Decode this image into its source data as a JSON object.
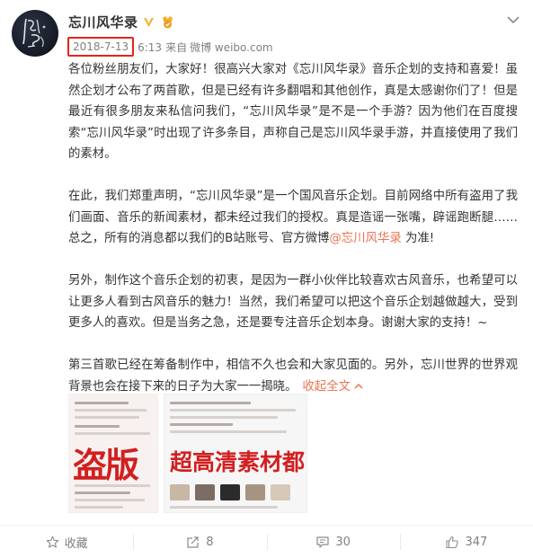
{
  "post": {
    "author": "忘川风华录",
    "date": "2018-7-13",
    "time": "6:13",
    "source_prefix": "来自",
    "source": "微博 weibo.com"
  },
  "content": {
    "p1": "各位粉丝朋友们，大家好！很高兴大家对《忘川风华录》音乐企划的支持和喜爱！虽然企划才公布了两首歌，但是已经有许多翻唱和其他创作，真是太感谢你们了！但是最近有很多朋友来私信问我们，“忘川风华录”是不是一个手游？因为他们在百度搜索“忘川风华录”时出现了许多条目，声称自己是忘川风华录手游，并直接使用了我们的素材。",
    "p2_before": "在此，我们郑重声明，“忘川风华录”是一个国风音乐企划。目前网络中所有盗用了我们画面、音乐的新闻素材，都未经过我们的授权。真是造谣一张嘴，辟谣跑断腿……总之，所有的消息都以我们的B站账号、官方微博",
    "p2_mention": "@忘川风华录",
    "p2_after": " 为准!",
    "p3": "另外，制作这个音乐企划的初衷，是因为一群小伙伴比较喜欢古风音乐，也希望可以让更多人看到古风音乐的魅力！当然，我们希望可以把这个音乐企划越做越大，受到更多人的喜欢。但是当务之急，还是要专注音乐企划本身。谢谢大家的支持！~",
    "p4": "第三首歌已经在筹备制作中，相信不久也会和大家见面的。另外，忘川世界的世界观背景也会在接下来的日子为大家一一揭晓。",
    "collapse_label": "收起全文",
    "collapse_arrow": "^"
  },
  "images": [
    {
      "text": "盗版"
    },
    {
      "text": "超高清素材都"
    }
  ],
  "actions": {
    "favorite_label": "收藏",
    "repost_count": "8",
    "comment_count": "30",
    "like_count": "347"
  },
  "colors": {
    "accent": "#eb7350",
    "highlight_box": "#e3261a",
    "verified": "#f6b026"
  },
  "icons": [
    "verified-icon",
    "vip-icon",
    "chevron-down-icon",
    "star-icon",
    "repost-icon",
    "comment-icon",
    "like-icon"
  ]
}
